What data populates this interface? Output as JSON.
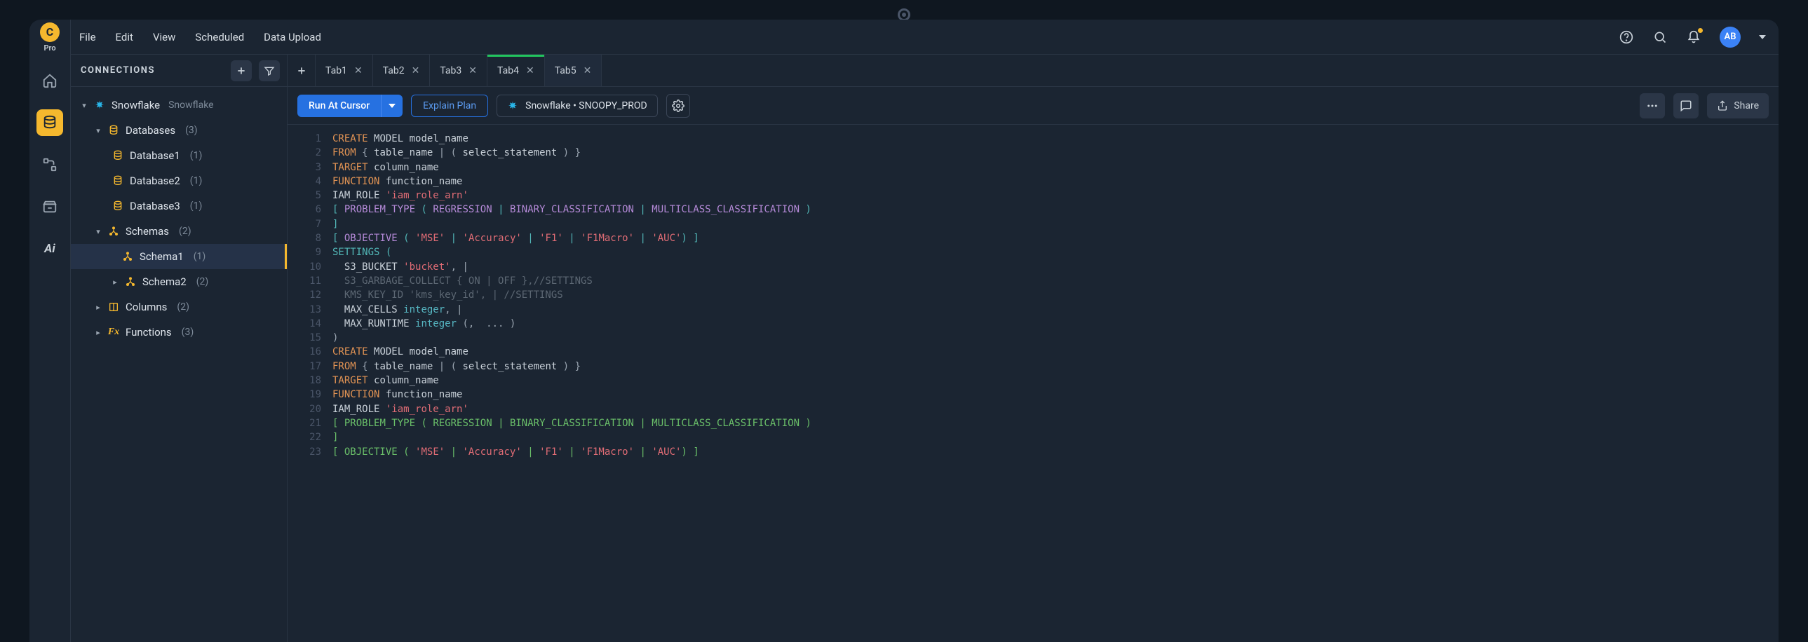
{
  "brand": {
    "logo_letter": "C",
    "pro_label": "Pro"
  },
  "menu": {
    "file": "File",
    "edit": "Edit",
    "view": "View",
    "scheduled": "Scheduled",
    "data_upload": "Data Upload"
  },
  "header": {
    "avatar_initials": "AB"
  },
  "sidebar": {
    "title": "CONNECTIONS",
    "connection": {
      "name": "Snowflake",
      "type": "Snowflake"
    },
    "groups": {
      "databases": {
        "label": "Databases",
        "count": "(3)",
        "items": [
          {
            "label": "Database1",
            "count": "(1)"
          },
          {
            "label": "Database2",
            "count": "(1)"
          },
          {
            "label": "Database3",
            "count": "(1)"
          }
        ]
      },
      "schemas": {
        "label": "Schemas",
        "count": "(2)",
        "items": [
          {
            "label": "Schema1",
            "count": "(1)"
          },
          {
            "label": "Schema2",
            "count": "(2)"
          }
        ]
      },
      "columns": {
        "label": "Columns",
        "count": "(2)"
      },
      "functions": {
        "label": "Functions",
        "count": "(3)"
      }
    }
  },
  "tabs": [
    {
      "label": "Tab1"
    },
    {
      "label": "Tab2"
    },
    {
      "label": "Tab3"
    },
    {
      "label": "Tab4"
    },
    {
      "label": "Tab5"
    }
  ],
  "toolbar": {
    "run_label": "Run At Cursor",
    "explain_label": "Explain Plan",
    "connection_label": "Snowflake • SNOOPY_PROD",
    "share_label": "Share"
  },
  "code_lines": 23,
  "colors": {
    "accent_yellow": "#f5b82e",
    "accent_blue": "#2671e1",
    "bg": "#1b2532"
  }
}
